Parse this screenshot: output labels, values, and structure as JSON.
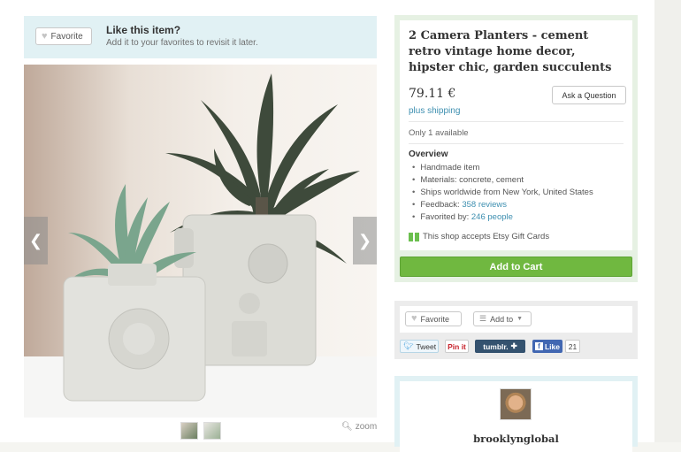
{
  "favorite_banner": {
    "button_label": "Favorite",
    "title": "Like this item?",
    "subtitle": "Add it to your favorites to revisit it later."
  },
  "gallery": {
    "zoom_label": "zoom",
    "thumbnail_count": 2
  },
  "product": {
    "title": "2 Camera Planters - cement retro vintage home decor, hipster chic, garden succulents",
    "price": "79.11 €",
    "shipping": "plus shipping",
    "ask_button": "Ask a Question",
    "availability": "Only 1 available",
    "overview_title": "Overview",
    "overview": {
      "item1": "Handmade item",
      "item2": "Materials: concrete, cement",
      "item3": "Ships worldwide from New York, United States",
      "feedback_label": "Feedback: ",
      "feedback_link": "358 reviews",
      "favorited_label": "Favorited by: ",
      "favorited_link": "246 people"
    },
    "gift_cards": "This shop accepts Etsy Gift Cards",
    "cart_button": "Add to Cart"
  },
  "share": {
    "favorite_label": "Favorite",
    "add_to_label": "Add to",
    "tweet_label": "Tweet",
    "pinit_label": "Pin it",
    "tumblr_label": "tumblr.",
    "fb_like_label": "Like",
    "fb_like_count": "21"
  },
  "shop": {
    "name": "brooklynglobal"
  },
  "colors": {
    "accent_green": "#70b840",
    "link_blue": "#3d8fb0",
    "banner_blue": "#e1f1f4",
    "panel_green": "#e6f1e3"
  }
}
